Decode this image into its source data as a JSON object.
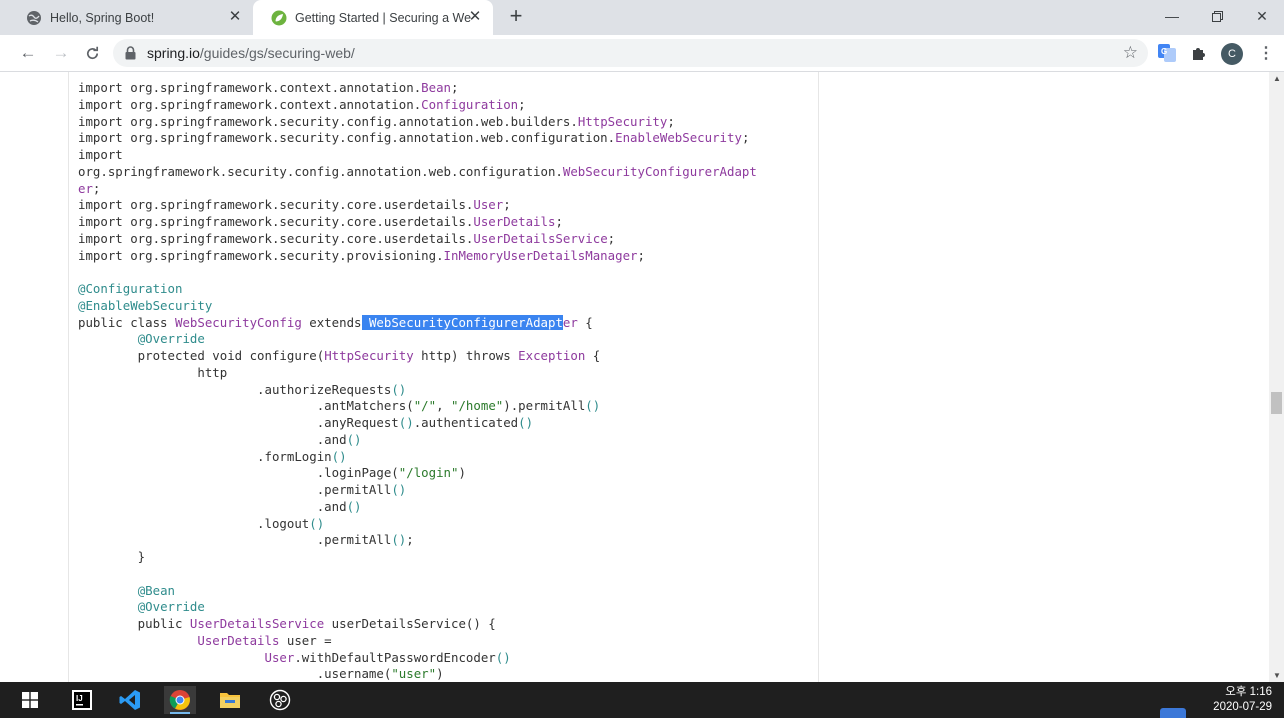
{
  "browser": {
    "tabs": [
      {
        "title": "Hello, Spring Boot!",
        "active": false
      },
      {
        "title": "Getting Started | Securing a We",
        "active": true
      }
    ],
    "new_tab": "+",
    "url_host": "spring.io",
    "url_path": "/guides/gs/securing-web/",
    "profile_initial": "C"
  },
  "code_lines": [
    [
      [
        "k",
        "import org.springframework.context.annotation."
      ],
      [
        "p",
        "Bean"
      ],
      [
        "k",
        ";"
      ]
    ],
    [
      [
        "k",
        "import org.springframework.context.annotation."
      ],
      [
        "p",
        "Configuration"
      ],
      [
        "k",
        ";"
      ]
    ],
    [
      [
        "k",
        "import org.springframework.security.config.annotation.web.builders."
      ],
      [
        "p",
        "HttpSecurity"
      ],
      [
        "k",
        ";"
      ]
    ],
    [
      [
        "k",
        "import org.springframework.security.config.annotation.web.configuration."
      ],
      [
        "p",
        "EnableWebSecurity"
      ],
      [
        "k",
        ";"
      ]
    ],
    [
      [
        "k",
        "import"
      ]
    ],
    [
      [
        "k",
        "org.springframework.security.config.annotation.web.configuration."
      ],
      [
        "p",
        "WebSecurityConfigurerAdapt"
      ]
    ],
    [
      [
        "p",
        "er"
      ],
      [
        "k",
        ";"
      ]
    ],
    [
      [
        "k",
        "import org.springframework.security.core.userdetails."
      ],
      [
        "p",
        "User"
      ],
      [
        "k",
        ";"
      ]
    ],
    [
      [
        "k",
        "import org.springframework.security.core.userdetails."
      ],
      [
        "p",
        "UserDetails"
      ],
      [
        "k",
        ";"
      ]
    ],
    [
      [
        "k",
        "import org.springframework.security.core.userdetails."
      ],
      [
        "p",
        "UserDetailsService"
      ],
      [
        "k",
        ";"
      ]
    ],
    [
      [
        "k",
        "import org.springframework.security.provisioning."
      ],
      [
        "p",
        "InMemoryUserDetailsManager"
      ],
      [
        "k",
        ";"
      ]
    ],
    [
      [
        "k",
        ""
      ]
    ],
    [
      [
        "a",
        "@Configuration"
      ]
    ],
    [
      [
        "a",
        "@EnableWebSecurity"
      ]
    ],
    [
      [
        "k",
        "public class "
      ],
      [
        "p",
        "WebSecurityConfig"
      ],
      [
        "k",
        " extends"
      ],
      [
        "sel",
        " WebSecurityConfigurerAdapt"
      ],
      [
        "p",
        "er"
      ],
      [
        "k",
        " {"
      ]
    ],
    [
      [
        "k",
        "        "
      ],
      [
        "a",
        "@Override"
      ]
    ],
    [
      [
        "k",
        "        protected void configure("
      ],
      [
        "p",
        "HttpSecurity"
      ],
      [
        "k",
        " http) throws "
      ],
      [
        "p",
        "Exception"
      ],
      [
        "k",
        " {"
      ]
    ],
    [
      [
        "k",
        "                http"
      ]
    ],
    [
      [
        "k",
        "                        .authorizeRequests"
      ],
      [
        "a",
        "()"
      ]
    ],
    [
      [
        "k",
        "                                .antMatchers("
      ],
      [
        "s",
        "\"/\""
      ],
      [
        "k",
        ", "
      ],
      [
        "s",
        "\"/home\""
      ],
      [
        "k",
        ").permitAll"
      ],
      [
        "a",
        "()"
      ]
    ],
    [
      [
        "k",
        "                                .anyRequest"
      ],
      [
        "a",
        "()"
      ],
      [
        "k",
        ".authenticated"
      ],
      [
        "a",
        "()"
      ]
    ],
    [
      [
        "k",
        "                                .and"
      ],
      [
        "a",
        "()"
      ]
    ],
    [
      [
        "k",
        "                        .formLogin"
      ],
      [
        "a",
        "()"
      ]
    ],
    [
      [
        "k",
        "                                .loginPage("
      ],
      [
        "s",
        "\"/login\""
      ],
      [
        "k",
        ")"
      ]
    ],
    [
      [
        "k",
        "                                .permitAll"
      ],
      [
        "a",
        "()"
      ]
    ],
    [
      [
        "k",
        "                                .and"
      ],
      [
        "a",
        "()"
      ]
    ],
    [
      [
        "k",
        "                        .logout"
      ],
      [
        "a",
        "()"
      ]
    ],
    [
      [
        "k",
        "                                .permitAll"
      ],
      [
        "a",
        "()"
      ],
      [
        "k",
        ";"
      ]
    ],
    [
      [
        "k",
        "        }"
      ]
    ],
    [
      [
        "k",
        ""
      ]
    ],
    [
      [
        "k",
        "        "
      ],
      [
        "a",
        "@Bean"
      ]
    ],
    [
      [
        "k",
        "        "
      ],
      [
        "a",
        "@Override"
      ]
    ],
    [
      [
        "k",
        "        public "
      ],
      [
        "p",
        "UserDetailsService"
      ],
      [
        "k",
        " userDetailsService() {"
      ]
    ],
    [
      [
        "k",
        "                "
      ],
      [
        "p",
        "UserDetails"
      ],
      [
        "k",
        " user ="
      ]
    ],
    [
      [
        "k",
        "                         "
      ],
      [
        "p",
        "User"
      ],
      [
        "k",
        ".withDefaultPasswordEncoder"
      ],
      [
        "a",
        "()"
      ]
    ],
    [
      [
        "k",
        "                                .username("
      ],
      [
        "s",
        "\"user\""
      ],
      [
        "k",
        ")"
      ]
    ]
  ],
  "taskbar": {
    "time": "오후 1:16",
    "date": "2020-07-29"
  }
}
